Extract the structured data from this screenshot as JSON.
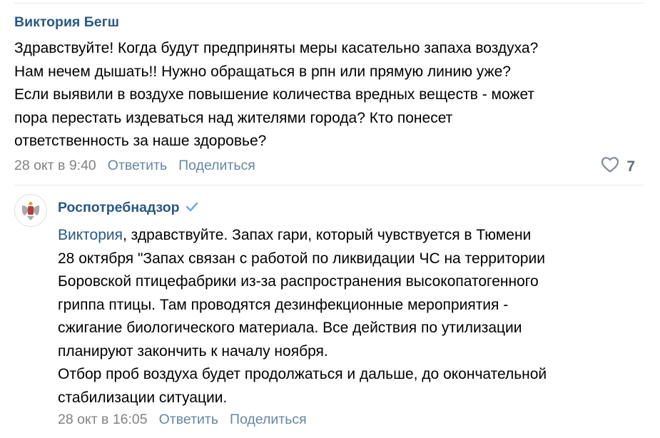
{
  "comment": {
    "author": "Виктория Бегш",
    "text": "Здравствуйте! Когда будут предприняты меры касательно запаха воздуха?\nНам нечем дышать!! Нужно обращаться в рпн или прямую линию уже?\nЕсли выявили в воздухе повышение количества вредных веществ - может\nпора перестать издеваться над жителями города? Кто понесет\nответственность за наше здоровье?",
    "date": "28 окт в 9:40",
    "reply_label": "Ответить",
    "share_label": "Поделиться",
    "likes": "7"
  },
  "reply": {
    "author": "Роспотребнадзор",
    "verified_icon": "checkmark-icon",
    "mention": "Виктория",
    "text": ", здравствуйте. Запах гари, который чувствуется в Тюмени\n28 октября \"Запах связан с работой по ликвидации ЧС на территории\nБоровской птицефабрики из-за распространения высокопатогенного\nгриппа птицы. Там проводятся дезинфекционные мероприятия -\nсжигание биологического материала. Все действия по утилизации\nпланируют закончить к началу ноября.\nОтбор проб воздуха будет продолжаться и дальше, до окончательной\nстабилизации ситуации.",
    "date": "28 окт в 16:05",
    "reply_label": "Ответить",
    "share_label": "Поделиться"
  },
  "colors": {
    "link": "#2a5885",
    "meta": "#828282",
    "divider": "#e7e8ec"
  }
}
